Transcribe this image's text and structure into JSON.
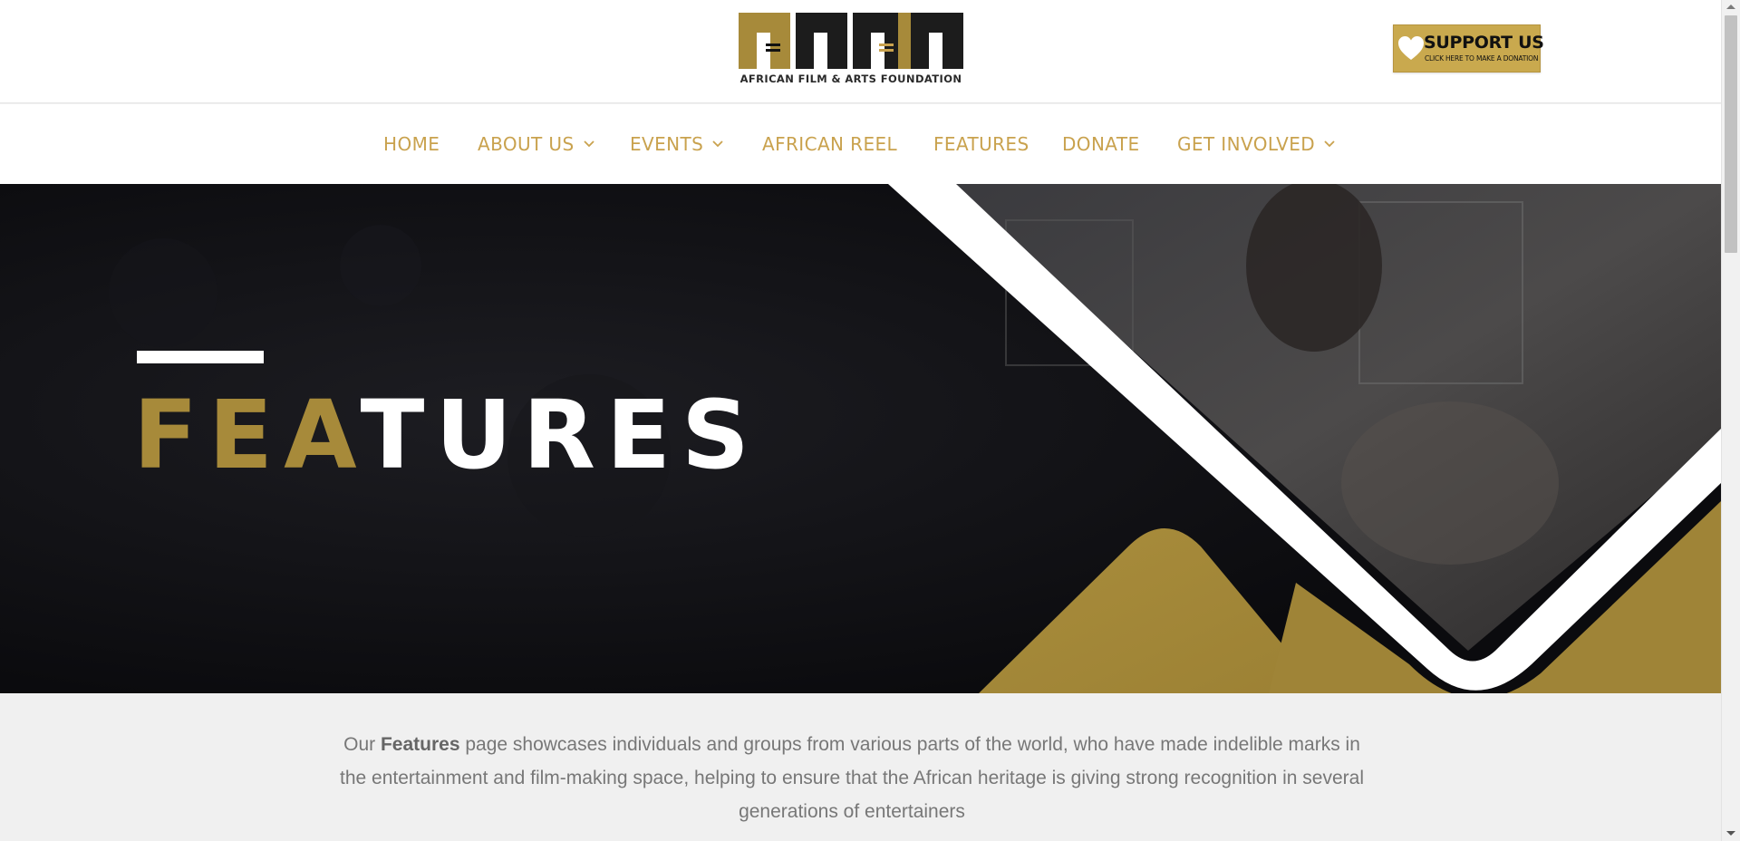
{
  "header": {
    "logo_text": "AFRICAN FILM & ARTS FOUNDATION",
    "support": {
      "title": "SUPPORT US",
      "subtitle": "CLICK HERE TO MAKE A DONATION",
      "icon": "heart-icon"
    }
  },
  "nav": {
    "items": [
      {
        "label": "HOME",
        "has_dropdown": false
      },
      {
        "label": "ABOUT US",
        "has_dropdown": true
      },
      {
        "label": "EVENTS",
        "has_dropdown": true
      },
      {
        "label": "AFRICAN REEL",
        "has_dropdown": false
      },
      {
        "label": "FEATURES",
        "has_dropdown": false
      },
      {
        "label": "DONATE",
        "has_dropdown": false
      },
      {
        "label": "GET INVOLVED",
        "has_dropdown": true
      }
    ],
    "dropdown_icon": "chevron-down-icon"
  },
  "hero": {
    "title_highlight": "FEA",
    "title_rest": "TURES"
  },
  "intro": {
    "prefix": "Our ",
    "bold": "Features",
    "suffix": " page showcases individuals and groups from various parts of the world, who have made indelible marks in the entertainment and film-making space, helping to ensure that the African heritage is giving strong recognition in several generations of entertainers"
  },
  "colors": {
    "brand_gold": "#c9a24e",
    "hero_gold": "#a78a3a",
    "hero_dark": "#0e0e12",
    "text_gray": "#777777"
  }
}
